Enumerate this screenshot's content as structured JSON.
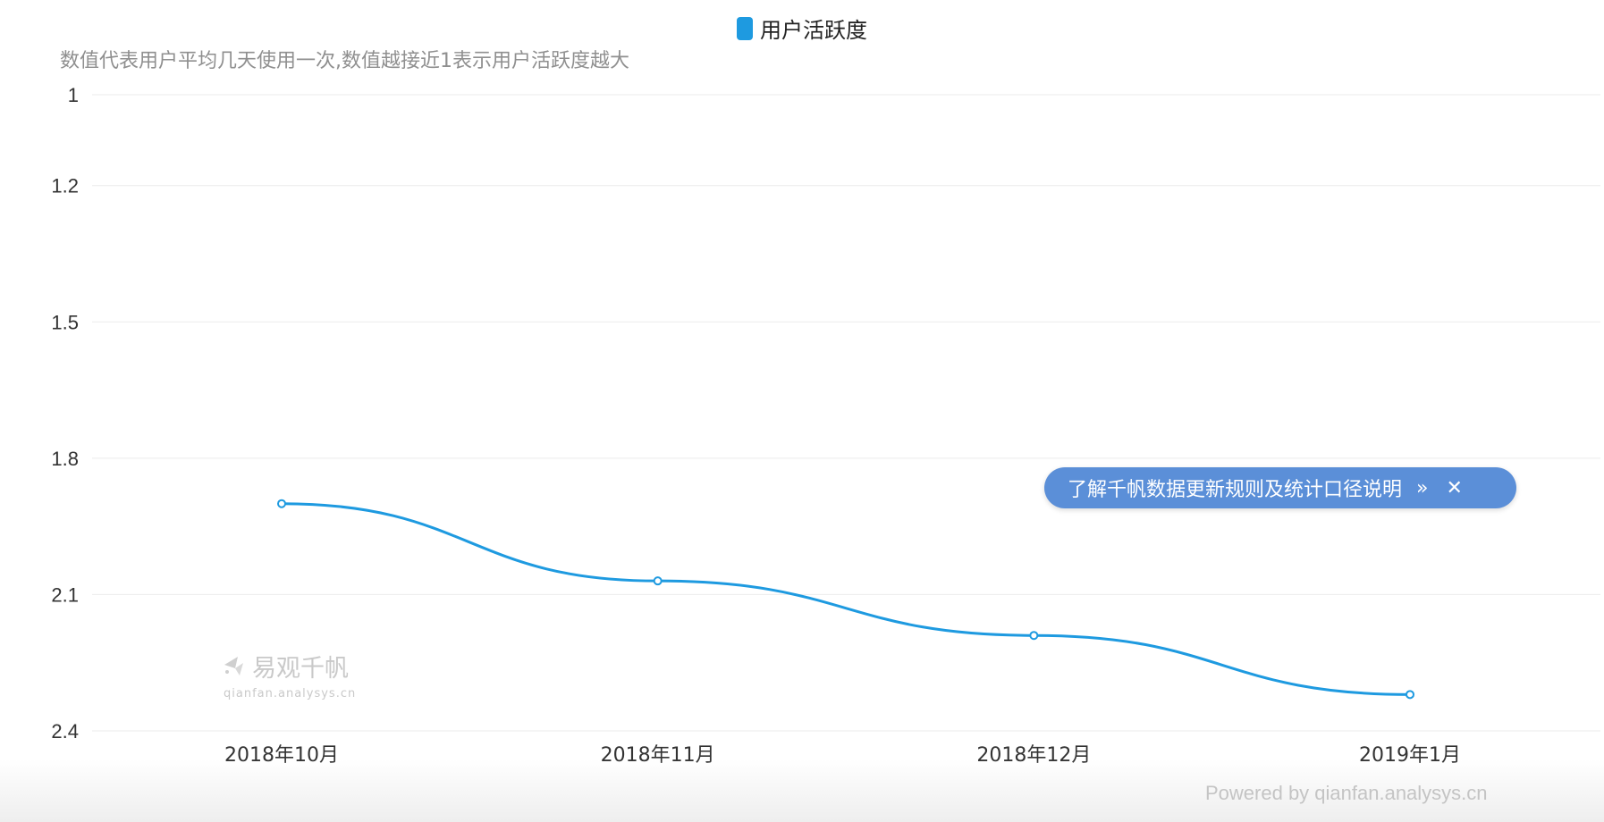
{
  "legend": {
    "label": "用户活跃度",
    "color": "#1e9ae0"
  },
  "subtitle": "数值代表用户平均几天使用一次,数值越接近1表示用户活跃度越大",
  "notice": {
    "text": "了解千帆数据更新规则及统计口径说明",
    "arrow": "»",
    "close": "✕"
  },
  "watermark": {
    "brand": "易观千帆",
    "domain": "qianfan.analysys.cn"
  },
  "powered_by": "Powered by qianfan.analysys.cn",
  "chart_data": {
    "type": "line",
    "categories": [
      "2018年10月",
      "2018年11月",
      "2018年12月",
      "2019年1月"
    ],
    "series": [
      {
        "name": "用户活跃度",
        "color": "#1e9ae0",
        "values": [
          1.9,
          2.07,
          2.19,
          2.32
        ]
      }
    ],
    "y_ticks": [
      1,
      1.2,
      1.5,
      1.8,
      2.1,
      2.4
    ],
    "y_tick_labels": [
      "1",
      "1.2",
      "1.5",
      "1.8",
      "2.1",
      "2.4"
    ],
    "ylim": [
      1,
      2.4
    ],
    "y_inverted": true,
    "grid": true
  }
}
